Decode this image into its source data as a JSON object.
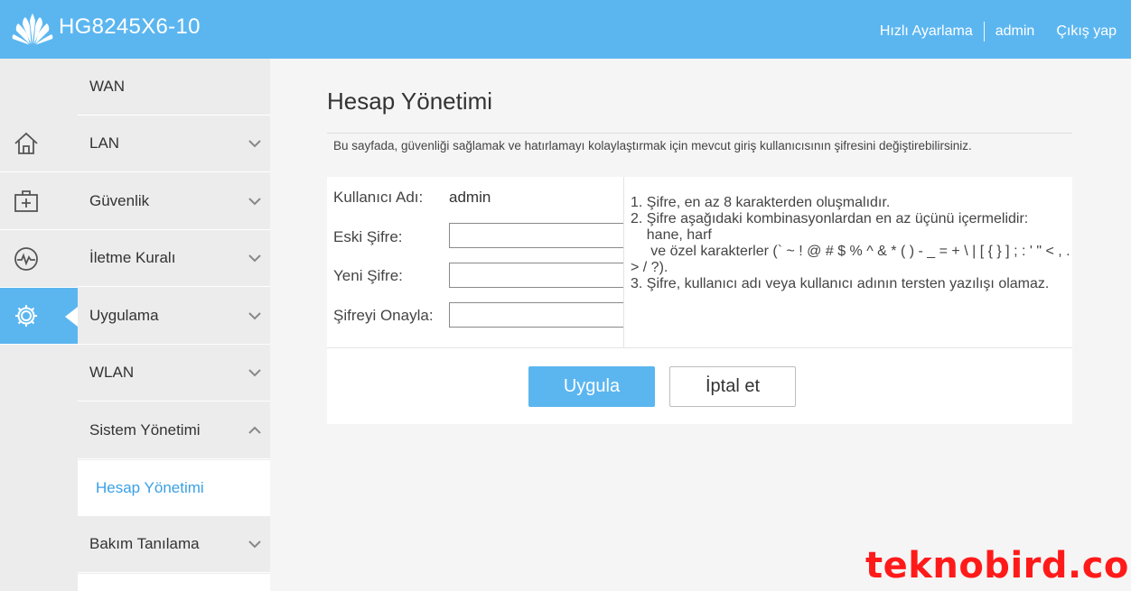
{
  "header": {
    "model": "HG8245X6-10",
    "links": [
      "Hızlı Ayarlama",
      "admin",
      "Çıkış yap"
    ]
  },
  "rail": {
    "items": [
      {
        "icon": "home-icon"
      },
      {
        "icon": "first-aid-kit-icon"
      },
      {
        "icon": "heartbeat-monitor-icon"
      },
      {
        "icon": "gear-icon",
        "active": true
      }
    ]
  },
  "menu": {
    "items": [
      {
        "label": "WAN"
      },
      {
        "label": "LAN"
      },
      {
        "label": "Güvenlik"
      },
      {
        "label": "İletme Kuralı"
      },
      {
        "label": "Uygulama"
      },
      {
        "label": "WLAN"
      },
      {
        "label": "Sistem Yönetimi"
      },
      {
        "label": "Bakım Tanılama"
      }
    ],
    "sub_item": "Hesap Yönetimi"
  },
  "content": {
    "title": "Hesap Yönetimi",
    "description": "Bu sayfada, güvenliği sağlamak ve hatırlamayı kolaylaştırmak için mevcut giriş kullanıcısının şifresini değiştirebilirsiniz.",
    "form": {
      "username_label": "Kullanıcı Adı:",
      "username_value": "admin",
      "old_password_label": "Eski Şifre:",
      "new_password_label": "Yeni Şifre:",
      "confirm_password_label": "Şifreyi Onayla:",
      "old_password_value": "",
      "new_password_value": "",
      "confirm_password_value": ""
    },
    "rules": [
      "1. Şifre, en az 8 karakterden oluşmalıdır.",
      "2. Şifre aşağıdaki kombinasyonlardan en az üçünü içermelidir:",
      "    hane, harf",
      "     ve özel karakterler (` ~ ! @ # $ % ^ & * ( ) - _ = + \\ | [ { } ] ; : ' \" < , . > / ?).",
      "3. Şifre, kullanıcı adı veya kullanıcı adının tersten yazılışı olamaz."
    ],
    "buttons": {
      "apply": "Uygula",
      "cancel": "İptal et"
    }
  },
  "watermark": "teknobird.com",
  "colors": {
    "header": "#5bb6f0",
    "accent_text": "#3aa0e6",
    "watermark": "#ff1a1a"
  }
}
